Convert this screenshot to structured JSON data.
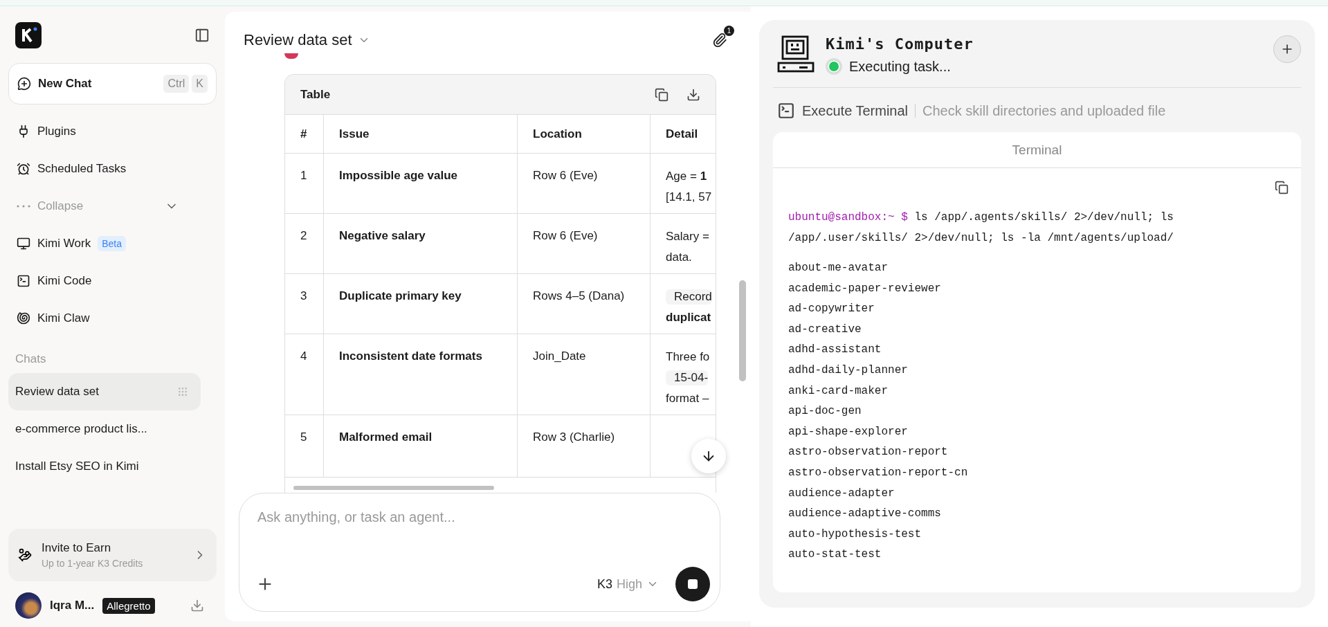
{
  "sidebar": {
    "new_chat": {
      "label": "New Chat",
      "keys": [
        "Ctrl",
        "K"
      ]
    },
    "nav": [
      {
        "kind": "plugins",
        "label": "Plugins"
      },
      {
        "kind": "scheduled",
        "label": "Scheduled Tasks"
      },
      {
        "kind": "collapse",
        "label": "Collapse"
      },
      {
        "kind": "work",
        "label": "Kimi Work",
        "badge": "Beta"
      },
      {
        "kind": "code",
        "label": "Kimi Code"
      },
      {
        "kind": "claw",
        "label": "Kimi Claw"
      }
    ],
    "chats_heading": "Chats",
    "chats": [
      {
        "label": "Review data set",
        "selected": true
      },
      {
        "label": "e-commerce product lis...",
        "selected": false
      },
      {
        "label": "Install Etsy SEO in Kimi",
        "selected": false
      }
    ],
    "invite": {
      "title": "Invite to Earn",
      "subtitle": "Up to 1-year K3 Credits"
    },
    "user": {
      "name": "Iqra M...",
      "plan": "Allegretto"
    }
  },
  "chat": {
    "title": "Review data set",
    "attachments": "1",
    "table": {
      "title": "Table",
      "columns": [
        "#",
        "Issue",
        "Location",
        "Detail"
      ],
      "rows": [
        {
          "cells": [
            "1",
            "Impossible age value",
            "Row 6 (Eve)"
          ],
          "detail": [
            {
              "kind": "text",
              "text": "Age = **1**"
            },
            {
              "kind": "text",
              "text": "[14.1, 57"
            }
          ]
        },
        {
          "cells": [
            "2",
            "Negative salary",
            "Row 6 (Eve)"
          ],
          "detail": [
            {
              "kind": "text",
              "text": "Salary ="
            },
            {
              "kind": "text",
              "text": "data."
            }
          ]
        },
        {
          "cells": [
            "3",
            "Duplicate primary key",
            "Rows 4–5 (Dana)"
          ],
          "detail": [
            {
              "kind": "code",
              "text": "Record"
            },
            {
              "kind": "strong",
              "text": "duplicat"
            }
          ]
        },
        {
          "cells": [
            "4",
            "Inconsistent date formats",
            "Join_Date"
          ],
          "detail": [
            {
              "kind": "text",
              "text": "Three fo"
            },
            {
              "kind": "code",
              "text": "15-04-"
            },
            {
              "kind": "text",
              "text": "format –"
            }
          ]
        },
        {
          "cells": [
            "5",
            "Malformed email",
            "Row 3 (Charlie)"
          ]
        }
      ]
    },
    "input": {
      "placeholder": "Ask anything, or task an agent...",
      "model": "K3",
      "effort": "High"
    }
  },
  "computer": {
    "title": "Kimi's Computer",
    "status": "Executing task...",
    "running": true,
    "step": {
      "tool": "Execute Terminal",
      "description": "Check skill directories and uploaded file"
    },
    "terminal": {
      "title": "Terminal",
      "prompt": "ubuntu@sandbox:~ $",
      "command": "ls /app/.agents/skills/ 2>/dev/null; ls /app/.user/skills/ 2>/dev/null; ls -la /mnt/agents/upload/",
      "output": [
        "about-me-avatar",
        "academic-paper-reviewer",
        "ad-copywriter",
        "ad-creative",
        "adhd-assistant",
        "adhd-daily-planner",
        "anki-card-maker",
        "api-doc-gen",
        "api-shape-explorer",
        "astro-observation-report",
        "astro-observation-report-cn",
        "audience-adapter",
        "audience-adaptive-comms",
        "auto-hypothesis-test",
        "auto-stat-test"
      ]
    }
  }
}
